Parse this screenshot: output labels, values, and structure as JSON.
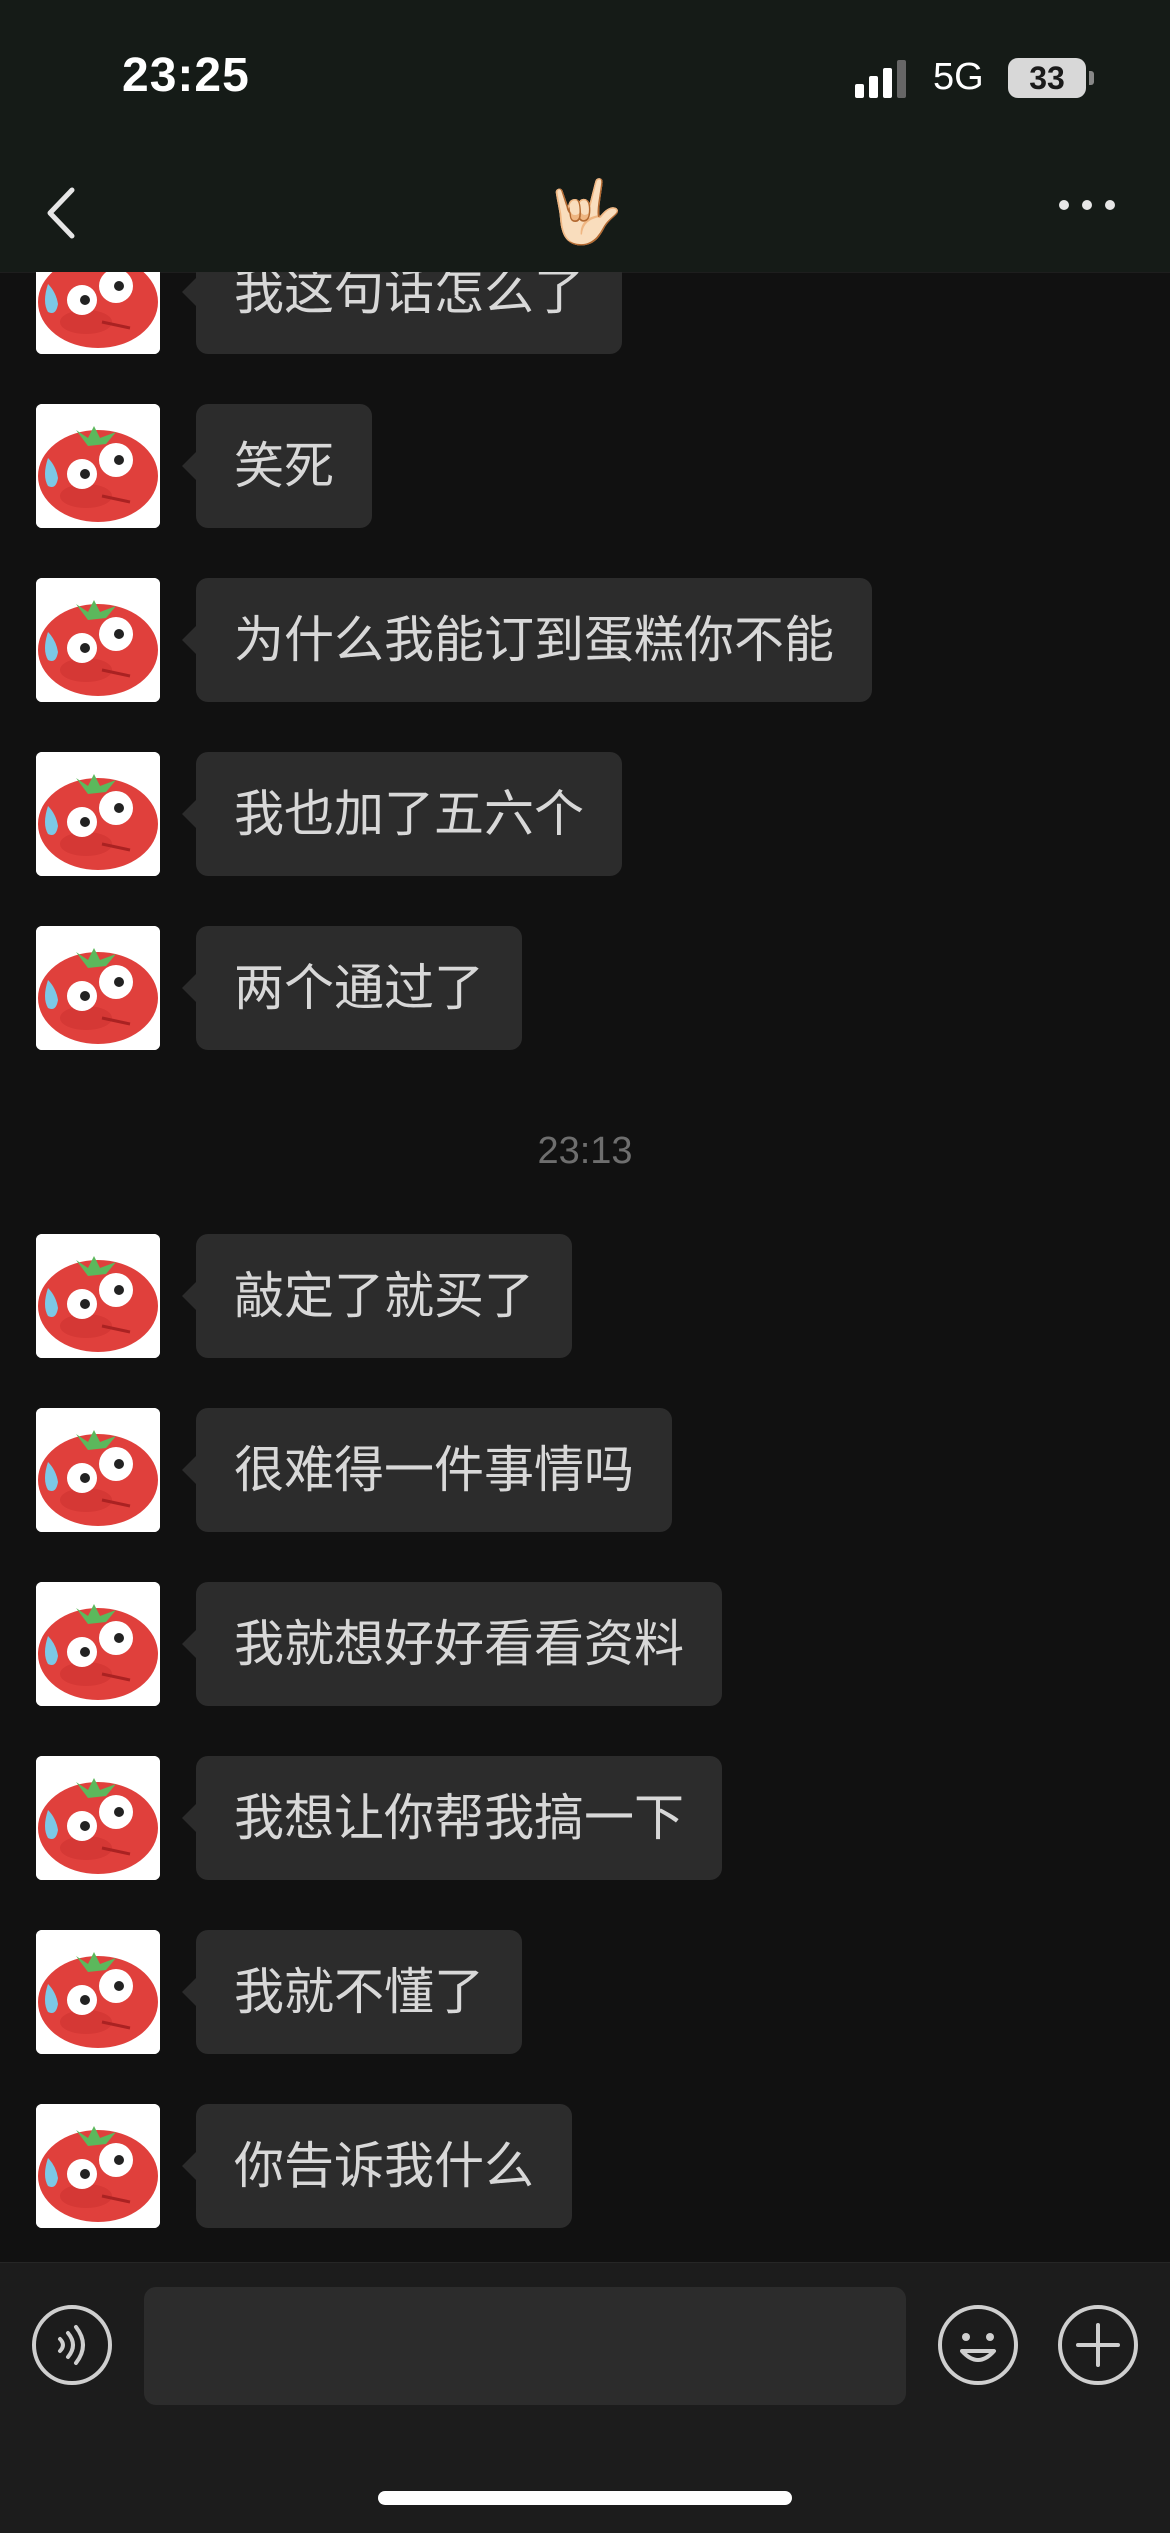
{
  "status_bar": {
    "time": "23:25",
    "network": "5G",
    "battery": "33"
  },
  "nav": {
    "title": "🤟🏻"
  },
  "chat": {
    "messages_before": [
      {
        "text": "我这句话怎么了"
      },
      {
        "text": "笑死"
      },
      {
        "text": "为什么我能订到蛋糕你不能"
      },
      {
        "text": "我也加了五六个"
      },
      {
        "text": "两个通过了"
      }
    ],
    "timestamp": "23:13",
    "messages_after": [
      {
        "text": "敲定了就买了"
      },
      {
        "text": "很难得一件事情吗"
      },
      {
        "text": "我就想好好看看资料"
      },
      {
        "text": "我想让你帮我搞一下"
      },
      {
        "text": "我就不懂了"
      },
      {
        "text": "你告诉我什么"
      }
    ]
  },
  "input": {
    "value": ""
  },
  "colors": {
    "background": "#111111",
    "bubble": "#2c2c2c",
    "header": "#151b17",
    "avatar_tomato": "#e0403c"
  },
  "icons": [
    "back-arrow-icon",
    "more-icon",
    "voice-icon",
    "emoji-icon",
    "plus-icon",
    "signal-icon",
    "tomato-avatar"
  ]
}
